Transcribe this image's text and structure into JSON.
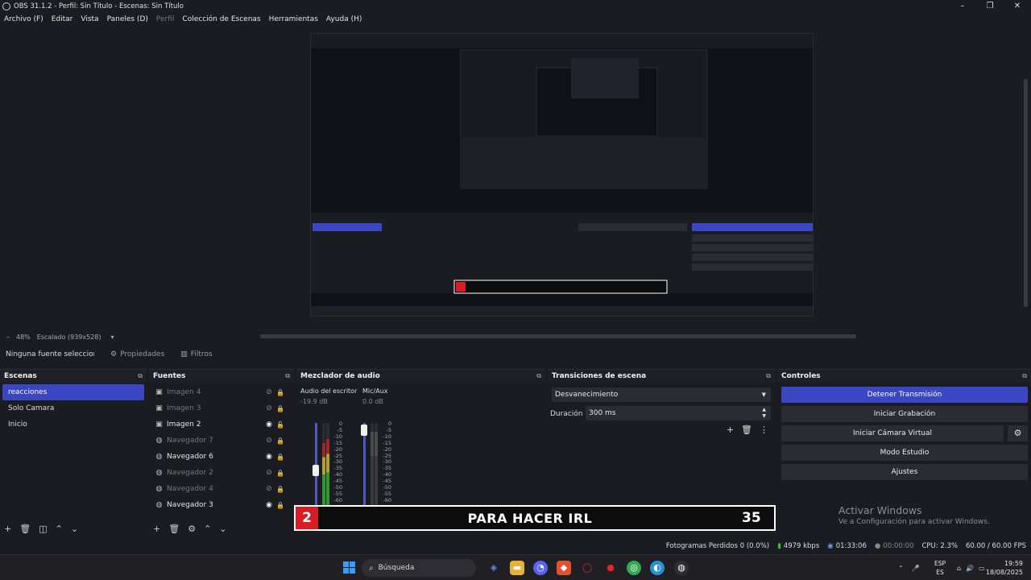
{
  "window": {
    "title": "OBS 31.1.2 - Perfil: Sin Título - Escenas: Sin Título",
    "controls": [
      "–",
      "❐",
      "✕"
    ]
  },
  "menu": [
    "Archivo (F)",
    "Editar",
    "Vista",
    "Paneles (D)",
    "Perfil",
    "Colección de Escenas",
    "Herramientas",
    "Ayuda (H)"
  ],
  "zoom": {
    "minus": "–",
    "level": "48%",
    "scale_label": "Escalado (939x528)",
    "caret": "▾"
  },
  "source_toolbar": {
    "no_selection": "Ninguna fuente seleccionada",
    "properties": "Propiedades",
    "filters": "Filtros"
  },
  "scenes": {
    "title": "Escenas",
    "items": [
      {
        "label": "reacciones",
        "active": true
      },
      {
        "label": "Solo Camara",
        "active": false
      },
      {
        "label": "Inicio",
        "active": false
      }
    ]
  },
  "sources": {
    "title": "Fuentes",
    "items": [
      {
        "label": "Imagen 4",
        "visible": false,
        "type": "image"
      },
      {
        "label": "Imagen 3",
        "visible": false,
        "type": "image"
      },
      {
        "label": "Imagen 2",
        "visible": true,
        "type": "image"
      },
      {
        "label": "Navegador 7",
        "visible": false,
        "type": "browser"
      },
      {
        "label": "Navegador 6",
        "visible": true,
        "type": "browser"
      },
      {
        "label": "Navegador 2",
        "visible": false,
        "type": "browser"
      },
      {
        "label": "Navegador 4",
        "visible": false,
        "type": "browser"
      },
      {
        "label": "Navegador 3",
        "visible": true,
        "type": "browser"
      }
    ]
  },
  "mixer": {
    "title": "Mezclador de audio",
    "channels": [
      {
        "name": "Audio del escritorio",
        "db": "-19.9 dB",
        "level": 0.47
      },
      {
        "name": "Mic/Aux",
        "db": "0.0 dB",
        "level": 0.92
      }
    ],
    "scale": [
      "0",
      "-5",
      "-10",
      "-15",
      "-20",
      "-25",
      "-30",
      "-35",
      "-40",
      "-45",
      "-50",
      "-55",
      "-60"
    ]
  },
  "transitions": {
    "title": "Transiciones de escena",
    "selected": "Desvanecimiento",
    "duration_label": "Duración",
    "duration_value": "300 ms"
  },
  "controls": {
    "title": "Controles",
    "stop_stream": "Detener Transmisión",
    "start_recording": "Iniciar Grabación",
    "virtual_camera": "Iniciar Cámara Virtual",
    "studio_mode": "Modo Estudio",
    "settings": "Ajustes"
  },
  "activate_windows": {
    "line1": "Activar Windows",
    "line2": "Ve a Configuración para activar Windows."
  },
  "overlay_banner": {
    "number": "2",
    "text": "PARA HACER IRL",
    "count": "35"
  },
  "status": {
    "dropped_frames": "Fotogramas Perdidos 0 (0.0%)",
    "bitrate": "4979 kbps",
    "stream_time": "01:33:06",
    "record_time": "00:00:00",
    "cpu": "CPU: 2.3%",
    "fps": "60.00 / 60.00 FPS"
  },
  "taskbar": {
    "search_placeholder": "Búsqueda",
    "lang_top": "ESP",
    "lang_bottom": "ES",
    "time": "19:59",
    "date": "18/08/2025"
  },
  "colors": {
    "accent": "#3b46c2",
    "banner_red": "#d81c24",
    "status_green": "#3cbc3c"
  }
}
